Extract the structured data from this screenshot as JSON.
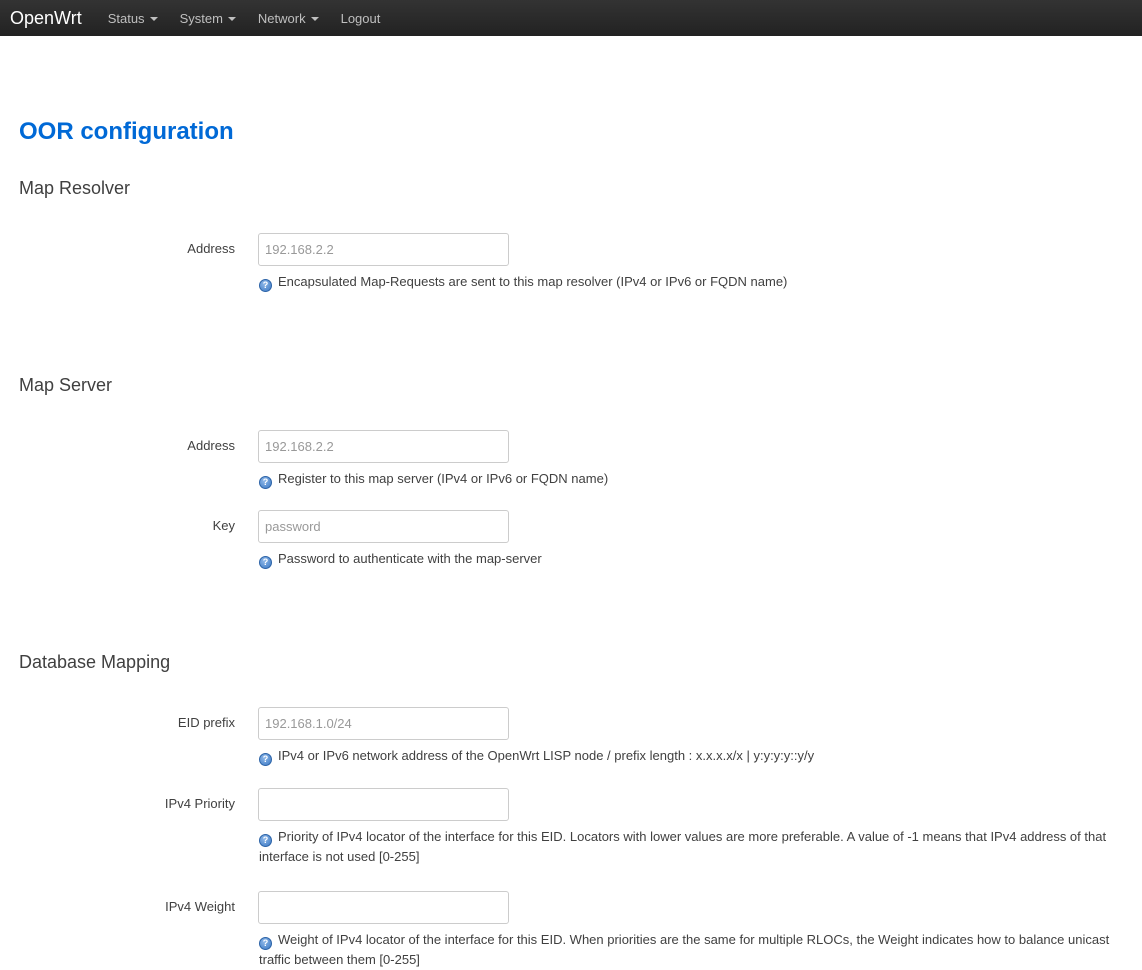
{
  "brand": "OpenWrt",
  "nav": [
    {
      "label": "Status",
      "dropdown": true
    },
    {
      "label": "System",
      "dropdown": true
    },
    {
      "label": "Network",
      "dropdown": true
    },
    {
      "label": "Logout",
      "dropdown": false
    }
  ],
  "page_title": "OOR configuration",
  "sections": {
    "map_resolver": {
      "title": "Map Resolver",
      "address": {
        "label": "Address",
        "placeholder": "192.168.2.2",
        "help": "Encapsulated Map-Requests are sent to this map resolver (IPv4 or IPv6 or FQDN name)"
      }
    },
    "map_server": {
      "title": "Map Server",
      "address": {
        "label": "Address",
        "placeholder": "192.168.2.2",
        "help": "Register to this map server (IPv4 or IPv6 or FQDN name)"
      },
      "key": {
        "label": "Key",
        "placeholder": "password",
        "help": "Password to authenticate with the map-server"
      }
    },
    "database_mapping": {
      "title": "Database Mapping",
      "eid_prefix": {
        "label": "EID prefix",
        "placeholder": "192.168.1.0/24",
        "help": "IPv4 or IPv6 network address of the OpenWrt LISP node / prefix length : x.x.x.x/x | y:y:y:y::y/y"
      },
      "ipv4_priority": {
        "label": "IPv4 Priority",
        "placeholder": "",
        "help": "Priority of IPv4 locator of the interface for this EID. Locators with lower values are more preferable. A value of -1 means that IPv4 address of that interface is not used [0-255]"
      },
      "ipv4_weight": {
        "label": "IPv4 Weight",
        "placeholder": "",
        "help": "Weight of IPv4 locator of the interface for this EID. When priorities are the same for multiple RLOCs, the Weight indicates how to balance unicast traffic between them [0-255]"
      }
    }
  },
  "help_icon": "help-icon",
  "colors": {
    "title": "#0069d6",
    "topbar": "#222222"
  }
}
